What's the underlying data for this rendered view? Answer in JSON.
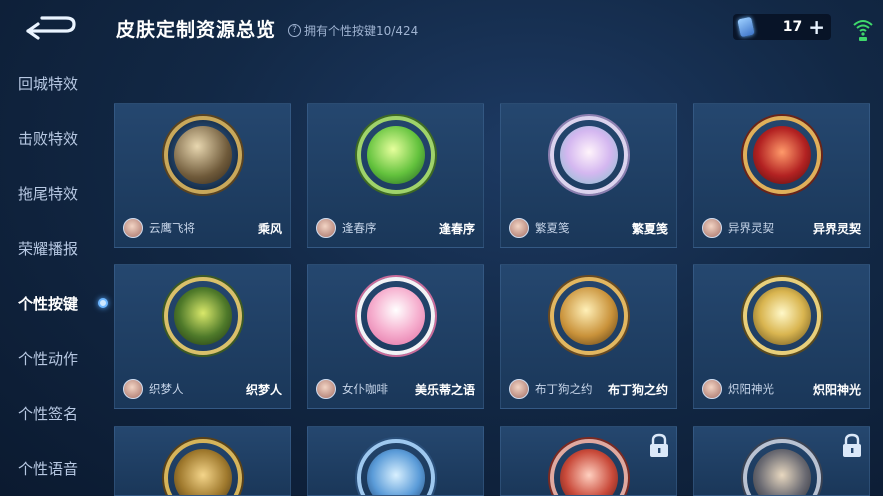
{
  "header": {
    "title": "皮肤定制资源总览",
    "owned_text": "拥有个性按键10/424",
    "help_icon": "?",
    "currency_value": "17",
    "plus_label": "+"
  },
  "sidebar": {
    "items": [
      {
        "label": "回城特效",
        "active": false
      },
      {
        "label": "击败特效",
        "active": false
      },
      {
        "label": "拖尾特效",
        "active": false
      },
      {
        "label": "荣耀播报",
        "active": false
      },
      {
        "label": "个性按键",
        "active": true
      },
      {
        "label": "个性动作",
        "active": false
      },
      {
        "label": "个性签名",
        "active": false
      },
      {
        "label": "个性语音",
        "active": false
      }
    ]
  },
  "colors": {
    "accent": "#58a8ff",
    "gold": "#c9a85a",
    "tile_bg": "#25476f"
  },
  "tiles": [
    {
      "hero": "云鹰飞将",
      "skin": "乘风",
      "locked": false,
      "art": "bronze-sword"
    },
    {
      "hero": "逢春序",
      "skin": "逢春序",
      "locked": false,
      "art": "green-leaf"
    },
    {
      "hero": "繁夏笺",
      "skin": "繁夏笺",
      "locked": false,
      "art": "pastel-flower"
    },
    {
      "hero": "异界灵契",
      "skin": "异界灵契",
      "locked": false,
      "art": "red-dragon"
    },
    {
      "hero": "织梦人",
      "skin": "织梦人",
      "locked": false,
      "art": "golden-dragon"
    },
    {
      "hero": "女仆咖啡",
      "skin": "美乐蒂之语",
      "locked": false,
      "art": "pink-bunny"
    },
    {
      "hero": "布丁狗之约",
      "skin": "布丁狗之约",
      "locked": false,
      "art": "gold-ring"
    },
    {
      "hero": "炽阳神光",
      "skin": "炽阳神光",
      "locked": false,
      "art": "sun-emblem"
    },
    {
      "hero": "",
      "skin": "",
      "locked": false,
      "art": "gold-medal"
    },
    {
      "hero": "",
      "skin": "",
      "locked": false,
      "art": "blue-blade"
    },
    {
      "hero": "",
      "skin": "",
      "locked": true,
      "art": "red-orb"
    },
    {
      "hero": "",
      "skin": "",
      "locked": true,
      "art": "dark-orb"
    }
  ]
}
